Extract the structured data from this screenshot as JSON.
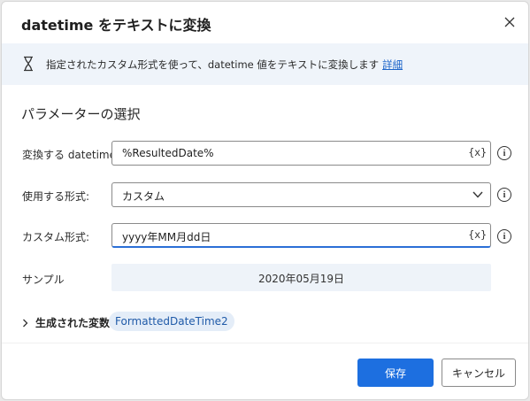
{
  "dialog": {
    "title": "datetime をテキストに変換",
    "close_icon": "close-icon"
  },
  "info": {
    "icon": "info-timer-icon",
    "text": "指定されたカスタム形式を使って、datetime 値をテキストに変換します",
    "link": "詳細"
  },
  "section": {
    "title": "パラメーターの選択"
  },
  "params": {
    "datetime_label": "変換する datetime:",
    "datetime_value": "%ResultedDate%",
    "format_label": "使用する形式:",
    "format_value": "カスタム",
    "custom_label": "カスタム形式:",
    "custom_value": "yyyy年MM月dd日",
    "sample_label": "サンプル",
    "sample_value": "2020年05月19日",
    "var_button": "{x}",
    "help_glyph": "i"
  },
  "output": {
    "expander_label": "生成された変数",
    "variable": "FormattedDateTime2"
  },
  "footer": {
    "save_label": "保存",
    "cancel_label": "キャンセル"
  },
  "colors": {
    "primary": "#1d6fe0",
    "info_bg": "#eff4fa",
    "chip_bg": "#e4edf8",
    "link": "#1a63c9"
  }
}
